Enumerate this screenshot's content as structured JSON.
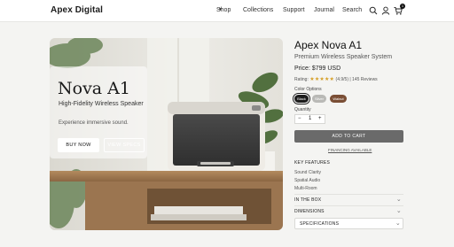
{
  "header": {
    "brand": "Apex Digital",
    "nav": [
      {
        "label": "Shop"
      },
      {
        "label": "Collections"
      },
      {
        "label": "Support"
      },
      {
        "label": "Journal"
      },
      {
        "label": "Search"
      }
    ],
    "cart_count": "1",
    "icons": [
      "search-icon",
      "user-icon",
      "cart-icon"
    ]
  },
  "hero": {
    "title": "Nova A1",
    "subtitle": "High-Fidelity Wireless Speaker",
    "note": "Experience immersive sound.",
    "buy_label": "BUY NOW",
    "specs_label": "VIEW SPECS"
  },
  "product": {
    "title": "Apex Nova A1",
    "subtitle": "Premium Wireless Speaker System",
    "price": "Price: $799 USD",
    "rating_prefix": "Rating:",
    "stars": "★★★★★",
    "rating_text": "(4.9/5) | 145 Reviews",
    "rating_value": 4.9,
    "color_label": "Color Options",
    "colors": [
      {
        "name": "Black",
        "hex": "#1c1c1c",
        "selected": true
      },
      {
        "name": "Silver",
        "hex": "#b9b9b6",
        "selected": false
      },
      {
        "name": "Walnut",
        "hex": "#7a4e35",
        "selected": false
      }
    ],
    "qty_label": "Quantity",
    "qty_minus": "−",
    "qty_value": "1",
    "qty_plus": "+",
    "cart_label": "ADD TO CART",
    "financing": "FINANCING AVAILABLE",
    "features_title": "KEY FEATURES",
    "features": [
      "Sound Clarity",
      "Spatial Audio",
      "Multi-Room"
    ],
    "accordions": [
      "IN THE BOX",
      "DIMENSIONS",
      "SPECIFICATIONS"
    ]
  },
  "colors": {
    "accent_star": "#d59e24",
    "cart_button": "#6a6a6a"
  }
}
